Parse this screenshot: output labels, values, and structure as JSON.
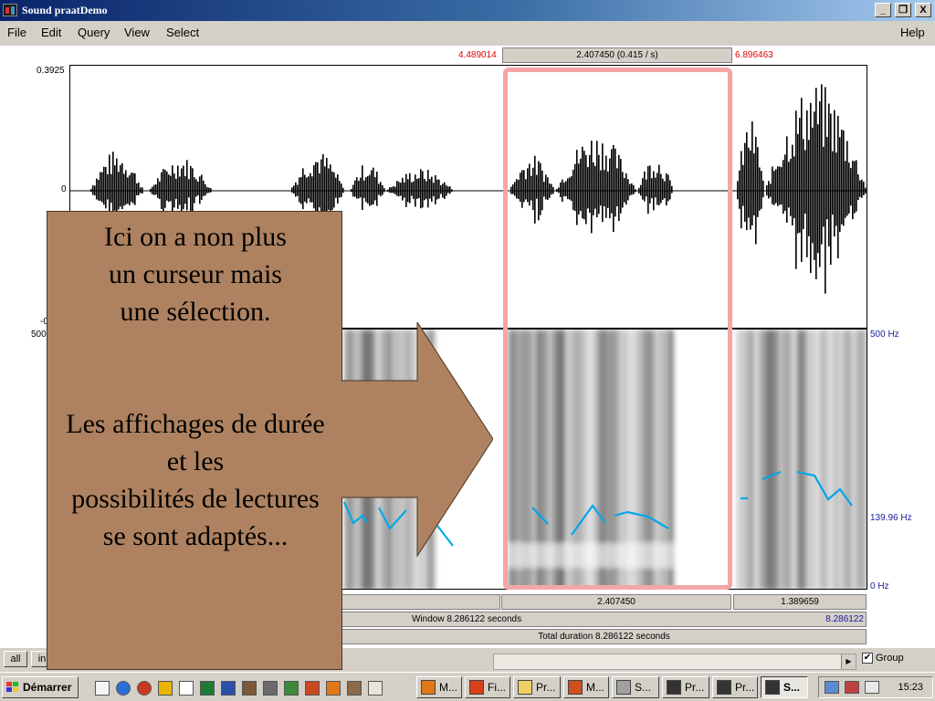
{
  "window": {
    "title": "Sound praatDemo",
    "icon": "praat-app-icon"
  },
  "window_controls": [
    {
      "name": "minimize-button",
      "glyph": "_"
    },
    {
      "name": "restore-button",
      "glyph": "❐"
    },
    {
      "name": "close-button",
      "glyph": "X"
    }
  ],
  "menu": {
    "file": "File",
    "edit": "Edit",
    "query": "Query",
    "view": "View",
    "select": "Select",
    "help": "Help"
  },
  "selection_info": {
    "start": "4.489014",
    "duration": "2.407450 (0.415 / s)",
    "end": "6.896463"
  },
  "waveform": {
    "y_top": "0.3925",
    "y_zero": "0",
    "y_bottom_partial": "-0"
  },
  "spectrogram": {
    "freq_top_left_partial": "500",
    "freq_top": "500 Hz",
    "pitch_mid": "139.96 Hz",
    "freq_bottom": "0 Hz"
  },
  "durations": {
    "segment_selected": "2.407450",
    "segment_after": "1.389659",
    "window_label": "Window 8.286122 seconds",
    "window_value": "8.286122",
    "total_label": "Total duration 8.286122 seconds"
  },
  "bottom_controls": {
    "all_button": "all",
    "in_button_partial": "in",
    "group_label": "Group",
    "group_checked": "✔"
  },
  "callout": {
    "line1": "Ici on a non plus",
    "line2": "un curseur mais",
    "line3": "une sélection.",
    "line4": "Les affichages de durée",
    "line5": "et les",
    "line6": "possibilités de lectures",
    "line7": "se sont adaptés...",
    "color": "#ae8260"
  },
  "taskbar": {
    "start_label": "Démarrer",
    "tasks": [
      {
        "label": "M...",
        "icon": "matlab-icon"
      },
      {
        "label": "Fi...",
        "icon": "firefox-icon"
      },
      {
        "label": "Pr...",
        "icon": "folder-icon"
      },
      {
        "label": "M...",
        "icon": "powerpoint-icon"
      },
      {
        "label": "S...",
        "icon": "sound-tool-icon"
      },
      {
        "label": "Pr...",
        "icon": "praat-icon"
      },
      {
        "label": "Pr...",
        "icon": "praat-icon"
      },
      {
        "label": "S...",
        "icon": "praat-icon"
      }
    ],
    "clock": "15:23"
  },
  "colors": {
    "selection_border": "#f4a6a6",
    "pitch_line": "#00a8e8",
    "red_time": "#e00000",
    "blue_axis": "#1a1aa0"
  }
}
